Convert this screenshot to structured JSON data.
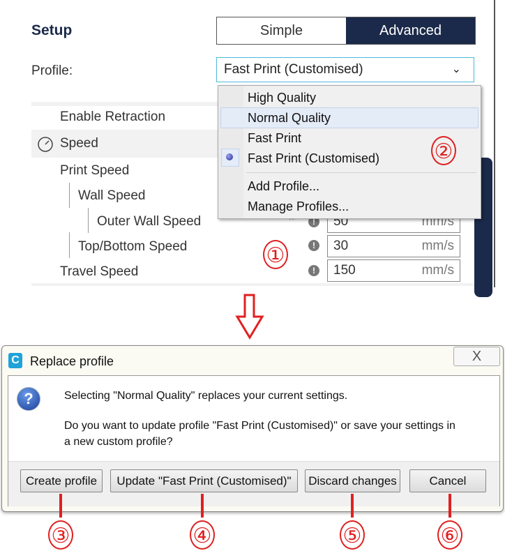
{
  "setup": {
    "title": "Setup",
    "modes": [
      "Simple",
      "Advanced"
    ],
    "active_mode": "Advanced"
  },
  "profile": {
    "label": "Profile:",
    "value": "Fast Print (Customised)"
  },
  "menu": {
    "items": [
      "High Quality",
      "Normal Quality",
      "Fast Print",
      "Fast Print (Customised)"
    ],
    "hovered": "Normal Quality",
    "selected": "Fast Print (Customised)",
    "actions": [
      "Add Profile...",
      "Manage Profiles..."
    ]
  },
  "settings": {
    "enable_retraction": "Enable Retraction",
    "speed": "Speed",
    "print_speed": "Print Speed",
    "wall_speed": "Wall Speed",
    "outer_wall_speed": {
      "label": "Outer Wall Speed",
      "value": "50",
      "unit": "mm/s"
    },
    "top_bottom_speed": {
      "label": "Top/Bottom Speed",
      "value": "30",
      "unit": "mm/s"
    },
    "travel_speed": {
      "label": "Travel Speed",
      "value": "150",
      "unit": "mm/s"
    }
  },
  "annotations": [
    "①",
    "②",
    "③",
    "④",
    "⑤",
    "⑥"
  ],
  "dialog": {
    "title": "Replace profile",
    "close": "X",
    "message1": "Selecting \"Normal Quality\" replaces your current settings.",
    "message2": "Do you want to update profile \"Fast Print (Customised)\" or save your settings in a new custom profile?",
    "buttons": [
      "Create profile",
      "Update \"Fast Print (Customised)\"",
      "Discard changes",
      "Cancel"
    ]
  },
  "colors": {
    "accent": "#1b2a4a",
    "annotation": "#e02020",
    "select_border": "#4fb8d8"
  }
}
